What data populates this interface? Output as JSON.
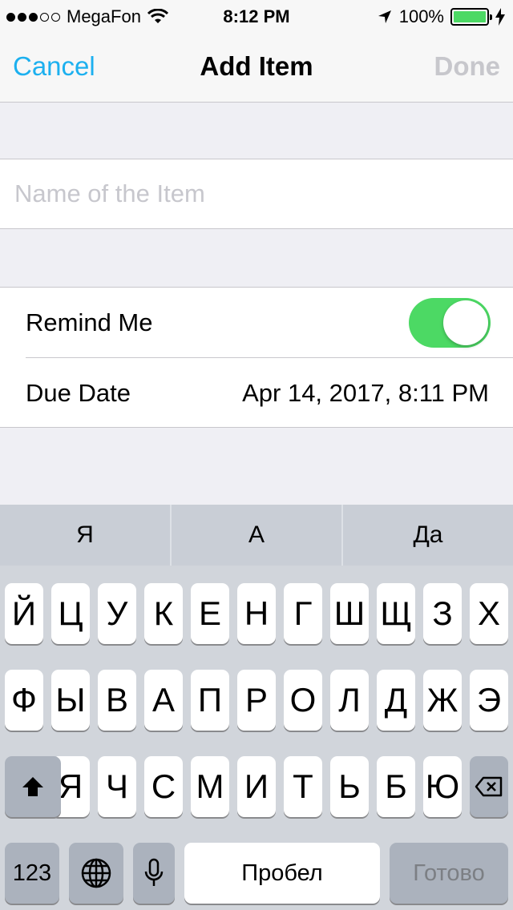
{
  "status_bar": {
    "carrier": "MegaFon",
    "time": "8:12 PM",
    "battery": "100%",
    "battery_level": 1.0
  },
  "nav": {
    "cancel_label": "Cancel",
    "title": "Add Item",
    "done_label": "Done"
  },
  "name_field": {
    "placeholder": "Name of the Item",
    "value": ""
  },
  "settings": {
    "remind_me_label": "Remind Me",
    "remind_me_on": true,
    "due_date_label": "Due Date",
    "due_date_value": "Apr 14, 2017, 8:11 PM"
  },
  "keyboard": {
    "suggestions": [
      "Я",
      "А",
      "Да"
    ],
    "row1": [
      "Й",
      "Ц",
      "У",
      "К",
      "Е",
      "Н",
      "Г",
      "Ш",
      "Щ",
      "З",
      "Х"
    ],
    "row2": [
      "Ф",
      "Ы",
      "В",
      "А",
      "П",
      "Р",
      "О",
      "Л",
      "Д",
      "Ж",
      "Э"
    ],
    "row3": [
      "Я",
      "Ч",
      "С",
      "М",
      "И",
      "Т",
      "Ь",
      "Б",
      "Ю"
    ],
    "numbers_label": "123",
    "space_label": "Пробел",
    "return_label": "Готово"
  },
  "colors": {
    "accent": "#1cb0ef",
    "toggle_on": "#4cd964",
    "done_disabled": "#c7c7cc",
    "battery": "#4cd964"
  }
}
